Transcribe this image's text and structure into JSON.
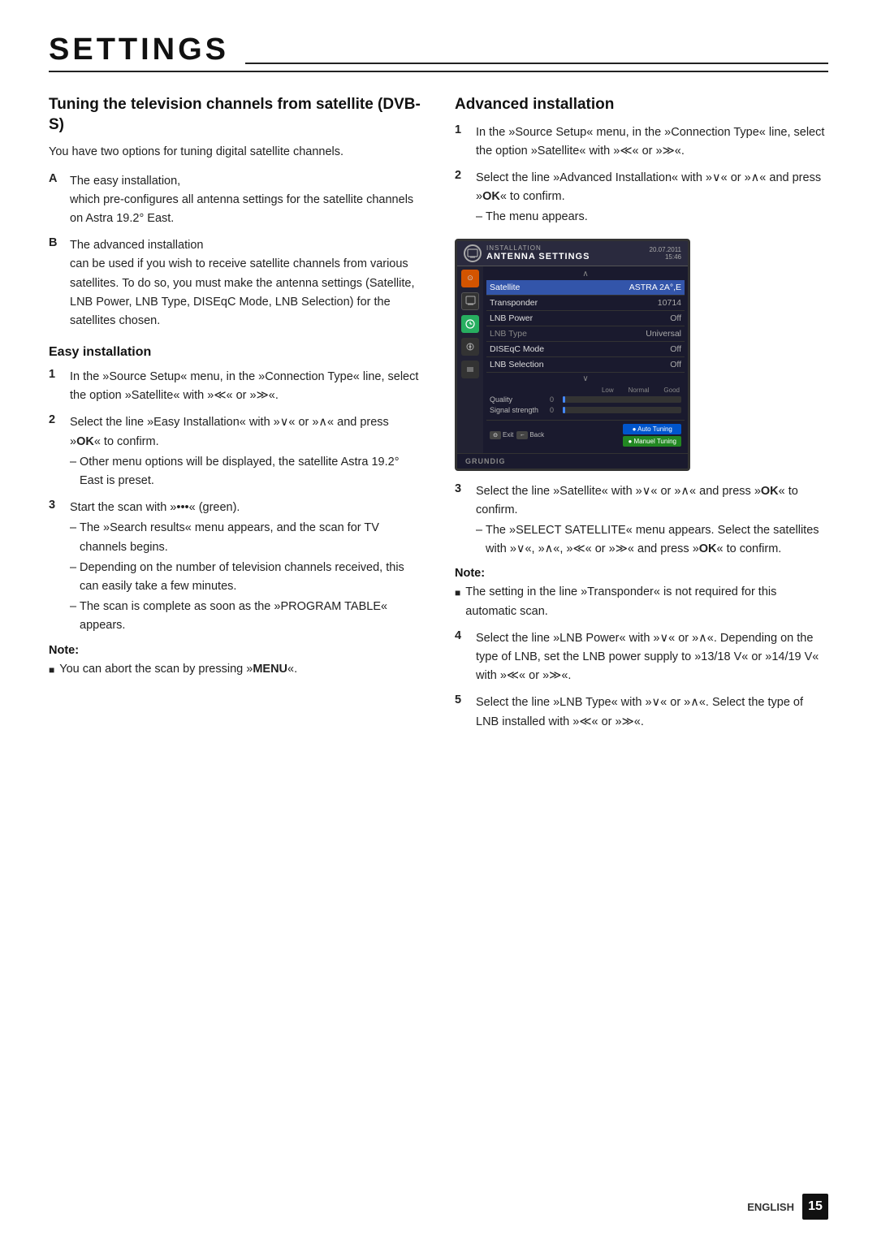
{
  "page": {
    "title": "SETTINGS",
    "language": "ENGLISH",
    "page_number": "15"
  },
  "left_column": {
    "main_heading": "Tuning the television channels from satellite (DVB-S)",
    "intro_text": "You have two options for tuning digital satellite channels.",
    "options": [
      {
        "label": "A",
        "main": "The easy installation,",
        "detail": "which pre-configures all antenna settings for the satellite channels on Astra 19.2° East."
      },
      {
        "label": "B",
        "main": "The advanced installation",
        "detail": "can be used if you wish to receive satellite channels from various satellites. To do so, you must make the antenna settings (Satellite, LNB Power, LNB Type, DISEqC Mode, LNB Selection) for the satellites chosen."
      }
    ],
    "easy_installation": {
      "title": "Easy installation",
      "steps": [
        {
          "num": "1",
          "text": "In the »Source Setup« menu, in the »Connection Type« line, select the option »Satellite« with »≪« or »≫«."
        },
        {
          "num": "2",
          "text": "Select the line »Easy Installation« with »∨« or »∧« and press »OK« to confirm.",
          "sub_items": [
            "Other menu options will be displayed, the satellite Astra 19.2° East is preset."
          ]
        },
        {
          "num": "3",
          "text": "Start the scan with »•••« (green).",
          "sub_items": [
            "The »Search results« menu appears, and the scan for TV channels begins.",
            "Depending on the number of television channels received, this can easily take a few minutes.",
            "The scan is complete as soon as the »PROGRAM TABLE« appears."
          ]
        }
      ],
      "note": {
        "label": "Note:",
        "items": [
          "You can abort the scan by pressing »MENU«."
        ]
      }
    }
  },
  "right_column": {
    "advanced_installation": {
      "title": "Advanced installation",
      "steps": [
        {
          "num": "1",
          "text": "In the »Source Setup« menu, in the »Connection Type« line, select the option »Satellite« with »≪« or »≫«."
        },
        {
          "num": "2",
          "text": "Select the line »Advanced Installation« with »∨« or »∧« and press »OK« to confirm.",
          "sub_items": [
            "The menu appears."
          ]
        },
        {
          "num": "3",
          "text": "Select the line »Satellite« with »∨« or »∧« and press »OK« to confirm.",
          "sub_items": [
            "The »SELECT SATELLITE« menu appears. Select the satellites with »∨«, »∧«, »≪« or »≫« and press »OK« to confirm."
          ]
        },
        {
          "num": "4",
          "text": "Select the line »LNB Power« with »∨« or »∧«. Depending on the type of LNB, set the LNB power supply to »13/18 V« or »14/19 V« with »≪« or »≫«."
        },
        {
          "num": "5",
          "text": "Select the line »LNB Type« with »∨« or »∧«. Select the type of LNB installed with »≪« or »≫«."
        }
      ],
      "note": {
        "label": "Note:",
        "items": [
          "The setting in the line »Transponder« is not required for this automatic scan."
        ]
      }
    },
    "tv_screen": {
      "installation_label": "INSTALLATION",
      "antenna_label": "ANTENNA SETTINGS",
      "date": "20.07.2011",
      "time": "15:46",
      "rows": [
        {
          "label": "Satellite",
          "value": "ASTRA 2A°,E",
          "style": "highlight"
        },
        {
          "label": "Transponder",
          "value": "10714",
          "style": "normal"
        },
        {
          "label": "LNB Power",
          "value": "Off",
          "style": "normal"
        },
        {
          "label": "LNB Type",
          "value": "Universal",
          "style": "dimmed"
        },
        {
          "label": "DISEqC Mode",
          "value": "Off",
          "style": "normal"
        },
        {
          "label": "LNB Selection",
          "value": "Off",
          "style": "normal"
        }
      ],
      "signal_labels": [
        "Low",
        "Normal",
        "Good"
      ],
      "signal_rows": [
        {
          "label": "Quality",
          "value": "0"
        },
        {
          "label": "Signal strength",
          "value": "0"
        }
      ],
      "buttons": [
        {
          "label": "Exit"
        },
        {
          "label": "Back"
        }
      ],
      "colored_buttons": [
        {
          "label": "Auto Tuning",
          "color": "blue"
        },
        {
          "label": "Manuel Tuning",
          "color": "green"
        }
      ],
      "brand": "GRUNDIG"
    }
  }
}
